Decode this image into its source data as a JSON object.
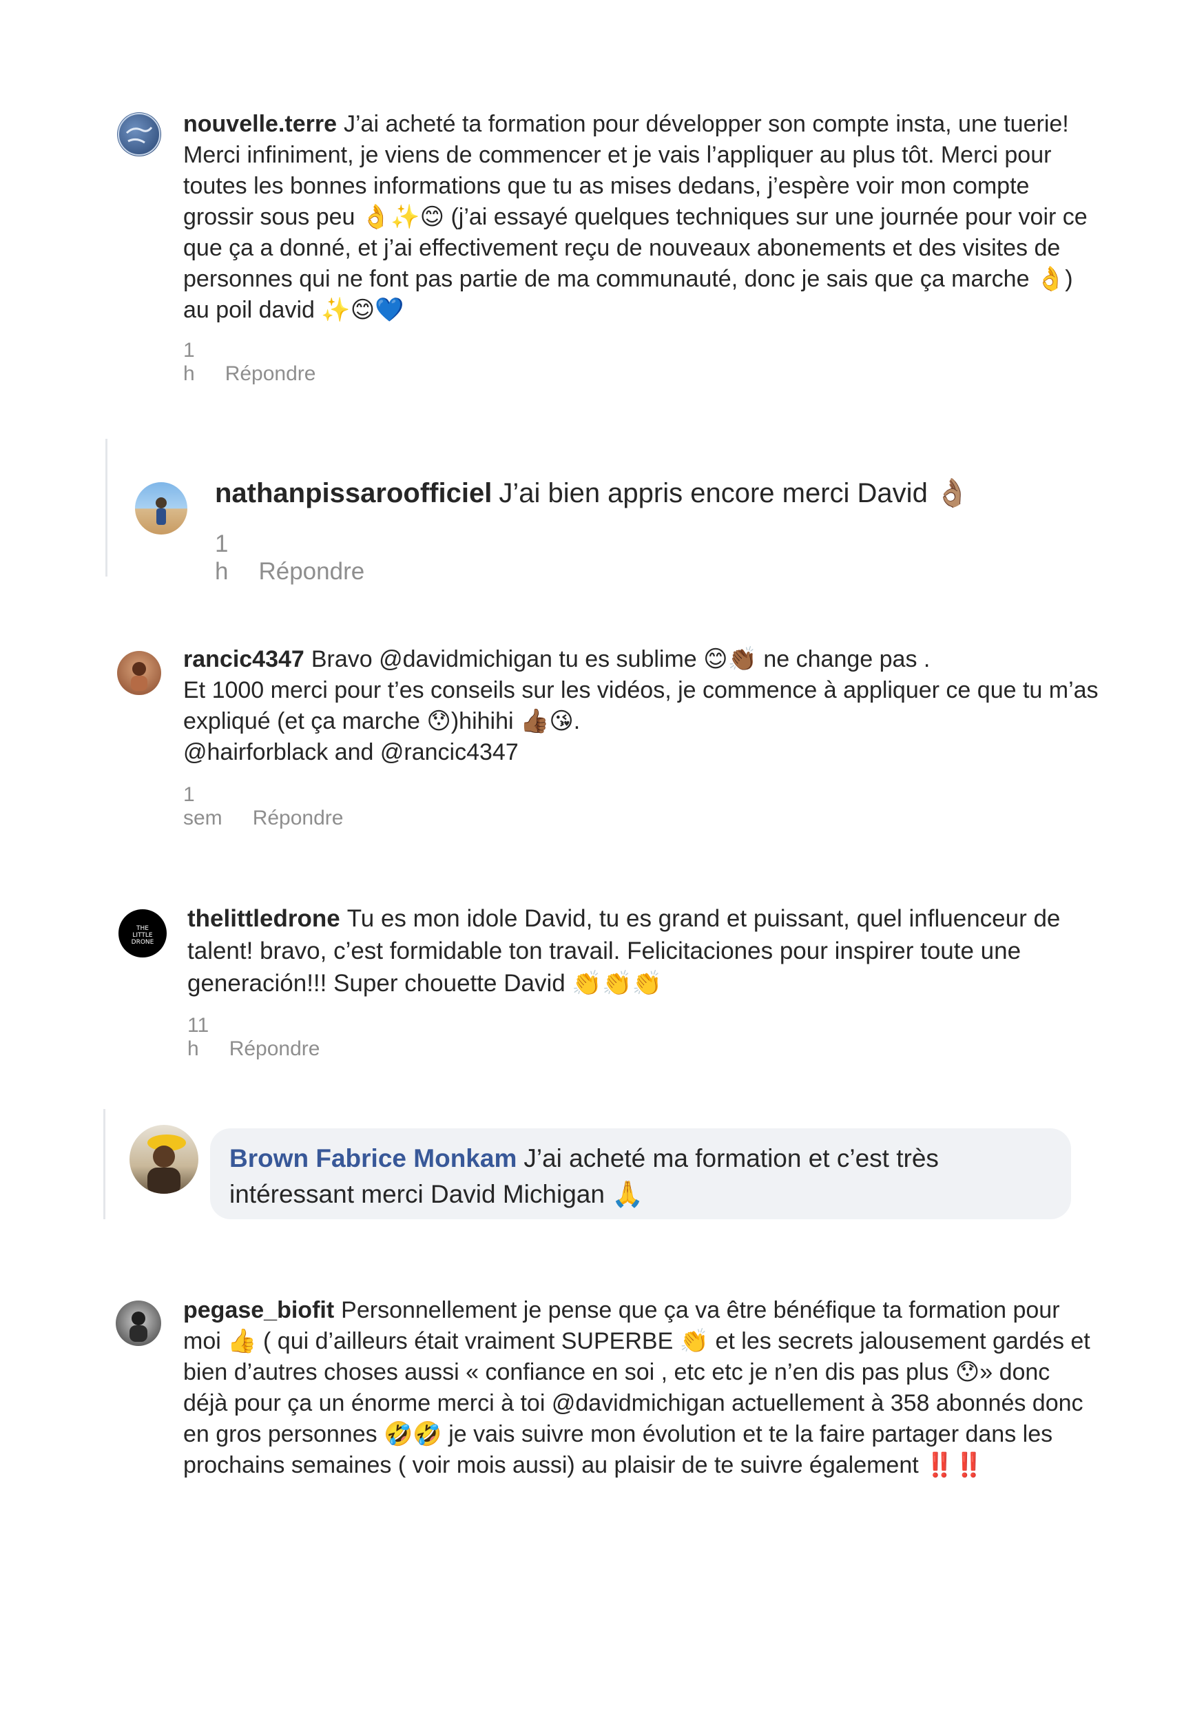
{
  "comments": [
    {
      "user": "nouvelle.terre",
      "text": "J’ai acheté ta formation pour développer son compte insta, une tuerie! Merci infiniment, je viens de commencer et je vais l’appliquer au plus tôt. Merci pour toutes les bonnes informations que tu as mises dedans, j’espère voir mon compte grossir sous peu 👌✨😊 (j’ai essayé quelques techniques sur une journée pour voir ce que ça a donné, et j’ai effectivement reçu de nouveaux abonements et des visites de personnes qui ne font pas partie de ma communauté, donc je sais que ça marche 👌) au poil david ✨😊💙",
      "time": "1 h",
      "reply": "Répondre"
    },
    {
      "user": "nathanpissaroofficiel",
      "text": "J’ai bien appris encore merci David 👌🏽",
      "time": "1 h",
      "reply": "Répondre"
    },
    {
      "user": "rancic4347",
      "text_line1": "Bravo @davidmichigan tu es sublime 😊👏🏾 ne change pas .",
      "text_line2": "Et 1000 merci pour t’es conseils sur les vidéos, je commence à appliquer ce que tu m’as expliqué (et ça marche 😯)hihihi 👍🏾😘.",
      "text_line3": "@hairforblack and @rancic4347",
      "time": "1 sem",
      "reply": "Répondre"
    },
    {
      "user": "thelittledrone",
      "text": "Tu es mon idole David, tu es grand et puissant, quel influenceur de talent! bravo, c’est formidable ton travail. Felicitaciones pour inspirer toute une generación!!! Super chouette David 👏👏👏",
      "time": "11 h",
      "reply": "Répondre"
    },
    {
      "user": "Brown Fabrice Monkam",
      "text": "J’ai acheté ma formation et c’est très intéressant merci David Michigan 🙏"
    },
    {
      "user": "pegase_biofit",
      "text": "Personnellement je pense que ça va être bénéfique ta formation pour moi 👍 ( qui d’ailleurs était vraiment SUPERBE 👏 et les secrets jalousement gardés et bien d’autres choses aussi «  confiance en soi , etc etc je n’en dis pas plus 😯» donc déjà pour ça un énorme merci à toi @davidmichigan actuellement à 358 abonnés donc en gros personnes 🤣🤣 je vais suivre mon évolution et te la faire partager dans les prochains semaines ( voir mois aussi) au plaisir de te suivre également ‼️‼️"
    }
  ],
  "drone_logo_text": "THE LITTLE DRONE",
  "colors": {
    "meta": "#8e8e8e",
    "fb_name": "#385898",
    "bubble": "#f0f2f5"
  }
}
